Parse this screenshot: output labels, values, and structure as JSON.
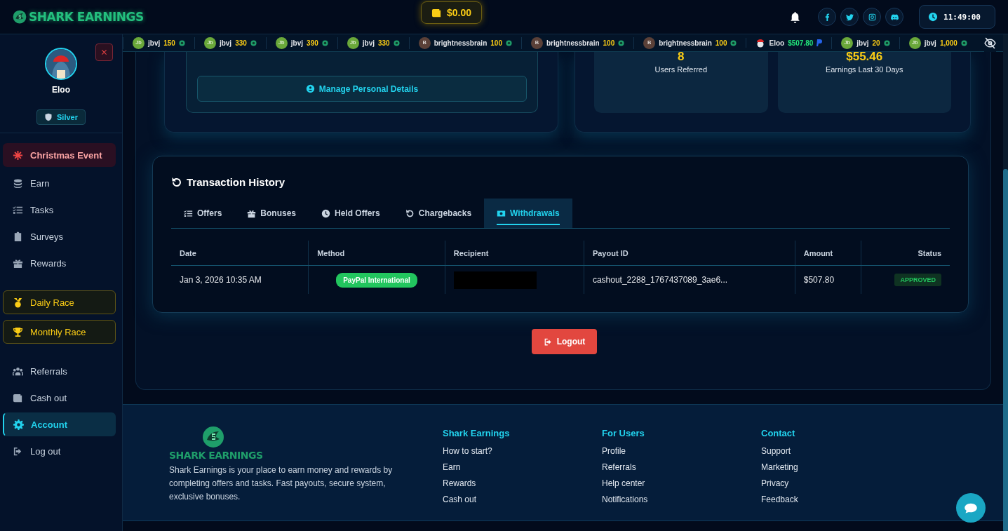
{
  "header": {
    "logo": "SHARK EARNINGS",
    "balance": "$0.00",
    "time": "11:49:00"
  },
  "ticker": [
    {
      "avatar": "Jb",
      "name": "jbvj",
      "amount": "150",
      "kind": "coins"
    },
    {
      "avatar": "Jb",
      "name": "jbvj",
      "amount": "330",
      "kind": "coins"
    },
    {
      "avatar": "Jb",
      "name": "jbvj",
      "amount": "390",
      "kind": "coins"
    },
    {
      "avatar": "Jb",
      "name": "jbvj",
      "amount": "330",
      "kind": "coins"
    },
    {
      "avatar": "B",
      "name": "brightnessbrain",
      "amount": "100",
      "kind": "coins"
    },
    {
      "avatar": "B",
      "name": "brightnessbrain",
      "amount": "100",
      "kind": "coins"
    },
    {
      "avatar": "B",
      "name": "brightnessbrain",
      "amount": "100",
      "kind": "coins"
    },
    {
      "name": "Eloo",
      "amount": "$507.80",
      "kind": "cash"
    },
    {
      "avatar": "Jb",
      "name": "jbvj",
      "amount": "20",
      "kind": "coins"
    },
    {
      "avatar": "Jb",
      "name": "jbvj",
      "amount": "1,000",
      "kind": "coins"
    }
  ],
  "sidebar": {
    "user": "Eloo",
    "tier": "Silver",
    "items": [
      {
        "label": "Christmas Event",
        "kind": "event",
        "selected": false
      },
      {
        "label": "Earn",
        "kind": "link",
        "selected": false
      },
      {
        "label": "Tasks",
        "kind": "link",
        "selected": false
      },
      {
        "label": "Surveys",
        "kind": "link",
        "selected": false
      },
      {
        "label": "Rewards",
        "kind": "link",
        "selected": false
      },
      {
        "label": "Daily Race",
        "kind": "race",
        "selected": false
      },
      {
        "label": "Monthly Race",
        "kind": "race",
        "selected": false
      },
      {
        "label": "Referrals",
        "kind": "link",
        "selected": false
      },
      {
        "label": "Cash out",
        "kind": "link",
        "selected": false
      },
      {
        "label": "Account",
        "kind": "link",
        "selected": true
      },
      {
        "label": "Log out",
        "kind": "link",
        "selected": false
      }
    ]
  },
  "profile_card": {
    "button": "Manage Personal Details"
  },
  "stats": [
    {
      "value": "8",
      "label": "Users Referred"
    },
    {
      "value": "$55.46",
      "label": "Earnings Last 30 Days"
    }
  ],
  "transactions": {
    "title": "Transaction History",
    "tabs": [
      {
        "label": "Offers",
        "selected": false
      },
      {
        "label": "Bonuses",
        "selected": false
      },
      {
        "label": "Held Offers",
        "selected": false
      },
      {
        "label": "Chargebacks",
        "selected": false
      },
      {
        "label": "Withdrawals",
        "selected": true
      }
    ],
    "table": {
      "columns": [
        "Date",
        "Method",
        "Recipient",
        "Payout ID",
        "Amount",
        "Status"
      ],
      "rows": [
        {
          "date": "Jan 3, 2026 10:35 AM",
          "method": "PayPal International",
          "recipient_redacted": true,
          "payout_id": "cashout_2288_1767437089_3ae6...",
          "amount": "$507.80",
          "status": "APPROVED"
        }
      ]
    }
  },
  "logout_button": "Logout",
  "footer": {
    "logo": "SHARK EARNINGS",
    "description": "Shark Earnings is your place to earn money and rewards by completing offers and tasks. Fast payouts, secure system, exclusive bonuses.",
    "columns": [
      {
        "title": "Shark Earnings",
        "links": [
          "How to start?",
          "Earn",
          "Rewards",
          "Cash out"
        ]
      },
      {
        "title": "For Users",
        "links": [
          "Profile",
          "Referrals",
          "Help center",
          "Notifications"
        ]
      },
      {
        "title": "Contact",
        "links": [
          "Support",
          "Marketing",
          "Privacy",
          "Feedback"
        ]
      }
    ]
  }
}
